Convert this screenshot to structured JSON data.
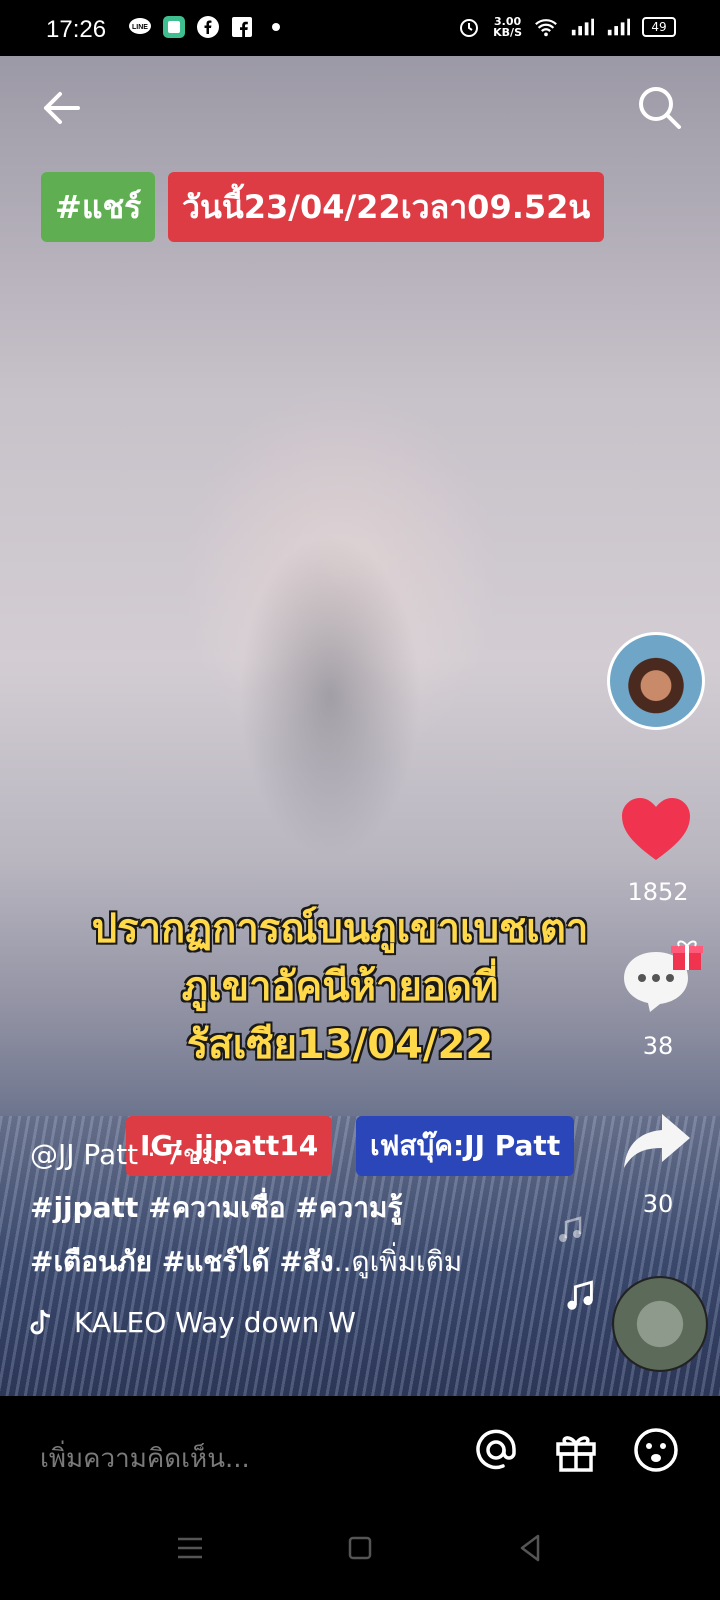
{
  "status_bar": {
    "time": "17:26",
    "speed_value": "3.00",
    "speed_unit": "KB/S",
    "battery": "49"
  },
  "header": {
    "back_icon": "back-arrow-icon",
    "search_icon": "search-icon"
  },
  "tags": {
    "green": "#แชร์",
    "red": "วันนี้23/04/22เวลา09.52น"
  },
  "video_overlay": {
    "lines": [
      "ปรากฏการณ์บนภูเขาเบชเตา",
      "ภูเขาอัคนีห้ายอดที่",
      "รัสเซีย13/04/22"
    ],
    "ig_badge": "IG: jjpatt14",
    "fb_badge": "เฟสบุ๊ค:JJ Patt"
  },
  "side_actions": {
    "likes": "1852",
    "comments": "38",
    "shares": "30"
  },
  "caption": {
    "user": "@JJ Patt · 7ชม.",
    "line1": "#jjpatt #ความเชื่อ #ความรู้",
    "line2": "#เตือนภัย #แชร์ได้ #สัง",
    "more": "..ดูเพิ่มเติม"
  },
  "music": {
    "track": "KALEO    Way down W"
  },
  "comment_bar": {
    "placeholder": "เพิ่มความคิดเห็น..."
  },
  "colors": {
    "like": "#f0344f",
    "green_tag": "#5fae52",
    "red_tag": "#de3c44",
    "fb_badge": "#2a46b8",
    "overlay_text": "#ffd94a"
  }
}
